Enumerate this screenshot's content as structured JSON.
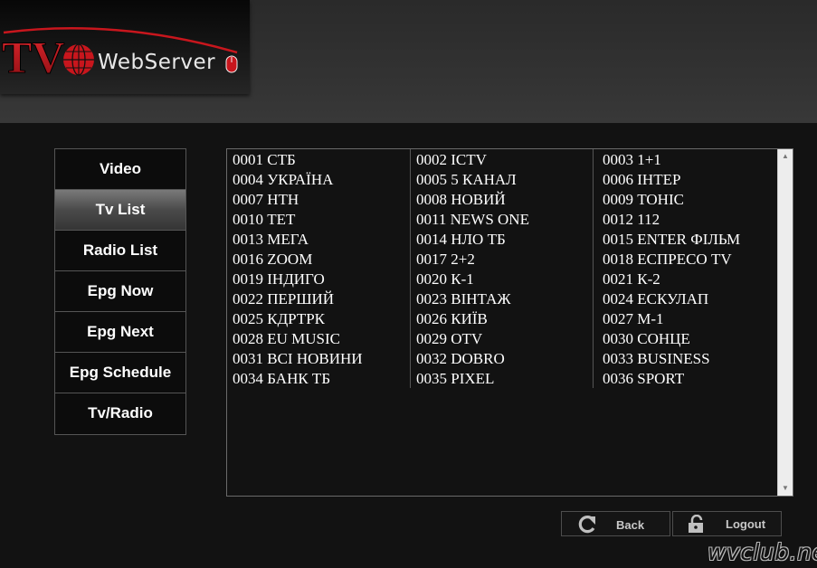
{
  "logo": {
    "tv": "TV",
    "brand": "WebServer"
  },
  "nav": {
    "items": [
      {
        "label": "Video",
        "active": false
      },
      {
        "label": "Tv List",
        "active": true
      },
      {
        "label": "Radio List",
        "active": false
      },
      {
        "label": "Epg Now",
        "active": false
      },
      {
        "label": "Epg Next",
        "active": false
      },
      {
        "label": "Epg Schedule",
        "active": false
      },
      {
        "label": "Tv/Radio",
        "active": false
      }
    ]
  },
  "channels": {
    "columns": [
      [
        "0001 СТБ",
        "0004 УКРАЇНА",
        "0007 НТН",
        "0010 ТЕТ",
        "0013 МЕГА",
        "0016 ZOOM",
        "0019 ІНДИГО",
        "0022 ПЕРШИЙ",
        "0025 КДРТРК",
        "0028 EU MUSIC",
        "0031 ВСІ НОВИНИ",
        "0034 БАНК ТБ"
      ],
      [
        "0002 ICTV",
        "0005 5 КАНАЛ",
        "0008 НОВИЙ",
        "0011 NEWS ONE",
        "0014 НЛО ТБ",
        "0017 2+2",
        "0020 К-1",
        "0023 ВІНТАЖ",
        "0026 КИЇВ",
        "0029 OTV",
        "0032 DOBRO",
        "0035 PIXEL"
      ],
      [
        "0003 1+1",
        "0006 ІНТЕР",
        "0009 ТОНІС",
        "0012 112",
        "0015 ENTER ФІЛЬМ",
        "0018 ЕСПРЕСО TV",
        "0021 К-2",
        "0024 ЕСКУЛАП",
        "0027 М-1",
        "0030 СОНЦЕ",
        "0033 BUSINESS",
        "0036 SPORT"
      ]
    ]
  },
  "buttons": {
    "back": "Back",
    "logout": "Logout"
  },
  "watermark": "wvclub.net",
  "colors": {
    "logo_red": "#c8161d",
    "active_tab": "#5a5a5a",
    "background": "#121212"
  }
}
